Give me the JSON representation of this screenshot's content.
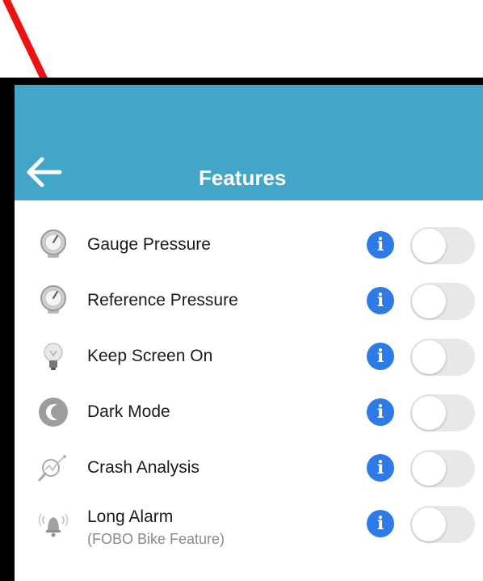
{
  "header": {
    "title": "Features",
    "color": "#43a5c8"
  },
  "features": [
    {
      "label": "Gauge Pressure",
      "subtitle": "",
      "icon": "gauge-icon",
      "enabled": false
    },
    {
      "label": "Reference Pressure",
      "subtitle": "",
      "icon": "gauge-icon",
      "enabled": false
    },
    {
      "label": "Keep Screen On",
      "subtitle": "",
      "icon": "lightbulb-icon",
      "enabled": false
    },
    {
      "label": "Dark Mode",
      "subtitle": "",
      "icon": "moon-icon",
      "enabled": false
    },
    {
      "label": "Crash Analysis",
      "subtitle": "",
      "icon": "magnifier-chart-icon",
      "enabled": false
    },
    {
      "label": "Long Alarm",
      "subtitle": "(FOBO Bike Feature)",
      "icon": "alarm-bell-icon",
      "enabled": false
    }
  ],
  "info_icon_glyph": "i",
  "annotation": {
    "icon": "red-arrow-icon",
    "color": "#ee1111"
  }
}
